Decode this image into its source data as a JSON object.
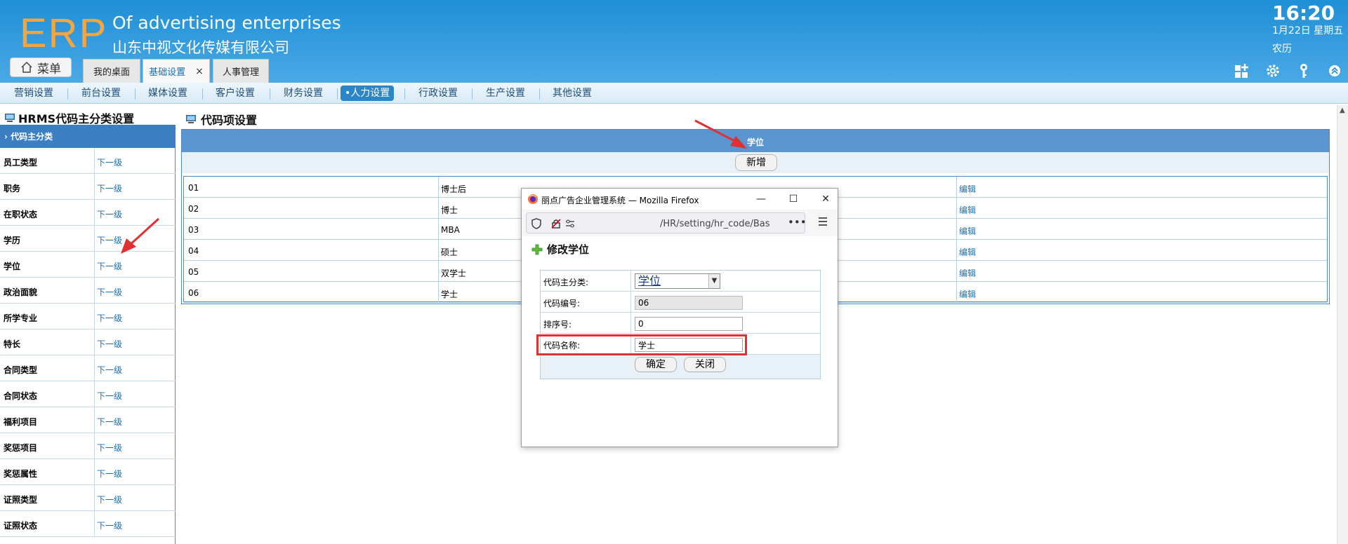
{
  "header": {
    "logo": "ERP",
    "company_en": "Of advertising enterprises",
    "company_cn": "山东中视文化传媒有限公司",
    "clock": "16:20",
    "date": "1月22日 星期五",
    "lunar": "农历",
    "menu_label": "菜单",
    "tabs": [
      {
        "label": "我的桌面"
      },
      {
        "label": "基础设置",
        "active": true,
        "close": "×"
      },
      {
        "label": "人事管理"
      }
    ],
    "tool_icons": [
      "layout-icon",
      "gear-icon",
      "key-icon",
      "collapse-icon"
    ]
  },
  "subnav": {
    "items": [
      {
        "label": "营销设置"
      },
      {
        "label": "前台设置"
      },
      {
        "label": "媒体设置"
      },
      {
        "label": "客户设置"
      },
      {
        "label": "财务设置"
      },
      {
        "label": "•人力设置",
        "active": true
      },
      {
        "label": "行政设置"
      },
      {
        "label": "生产设置"
      },
      {
        "label": "其他设置"
      }
    ]
  },
  "left": {
    "title": "HRMS代码主分类设置",
    "head": "代码主分类",
    "rows": [
      {
        "name": "员工类型",
        "link": "下一级"
      },
      {
        "name": "职务",
        "link": "下一级"
      },
      {
        "name": "在职状态",
        "link": "下一级"
      },
      {
        "name": "学历",
        "link": "下一级"
      },
      {
        "name": "学位",
        "link": "下一级"
      },
      {
        "name": "政治面貌",
        "link": "下一级"
      },
      {
        "name": "所学专业",
        "link": "下一级"
      },
      {
        "name": "特长",
        "link": "下一级"
      },
      {
        "name": "合同类型",
        "link": "下一级"
      },
      {
        "name": "合同状态",
        "link": "下一级"
      },
      {
        "name": "福利项目",
        "link": "下一级"
      },
      {
        "name": "奖惩项目",
        "link": "下一级"
      },
      {
        "name": "奖惩属性",
        "link": "下一级"
      },
      {
        "name": "证照类型",
        "link": "下一级"
      },
      {
        "name": "证照状态",
        "link": "下一级"
      }
    ]
  },
  "main": {
    "title": "代码项设置",
    "table_head": "学位",
    "add_label": "新增",
    "rows": [
      {
        "code": "01",
        "name": "博士后",
        "action": "编辑"
      },
      {
        "code": "02",
        "name": "博士",
        "action": "编辑"
      },
      {
        "code": "03",
        "name": "MBA",
        "action": "编辑"
      },
      {
        "code": "04",
        "name": "硕士",
        "action": "编辑"
      },
      {
        "code": "05",
        "name": "双学士",
        "action": "编辑"
      },
      {
        "code": "06",
        "name": "学士",
        "action": "编辑"
      }
    ]
  },
  "popup": {
    "window_title": "丽点广告企业管理系统 — Mozilla Firefox",
    "url": "/HR/setting/hr_code/Bas",
    "url_more": "•••",
    "form_title": "修改学位",
    "fields": {
      "category_label": "代码主分类:",
      "category_value": "学位",
      "code_label": "代码编号:",
      "code_value": "06",
      "order_label": "排序号:",
      "order_value": "0",
      "name_label": "代码名称:",
      "name_value": "学士"
    },
    "confirm_label": "确定",
    "close_label": "关闭"
  },
  "colors": {
    "header_blue": "#2a92d8",
    "logo_orange": "#f7a53c",
    "table_head_blue": "#5a95d2",
    "link_blue": "#1a6fb5",
    "annotation_red": "#e03030"
  }
}
